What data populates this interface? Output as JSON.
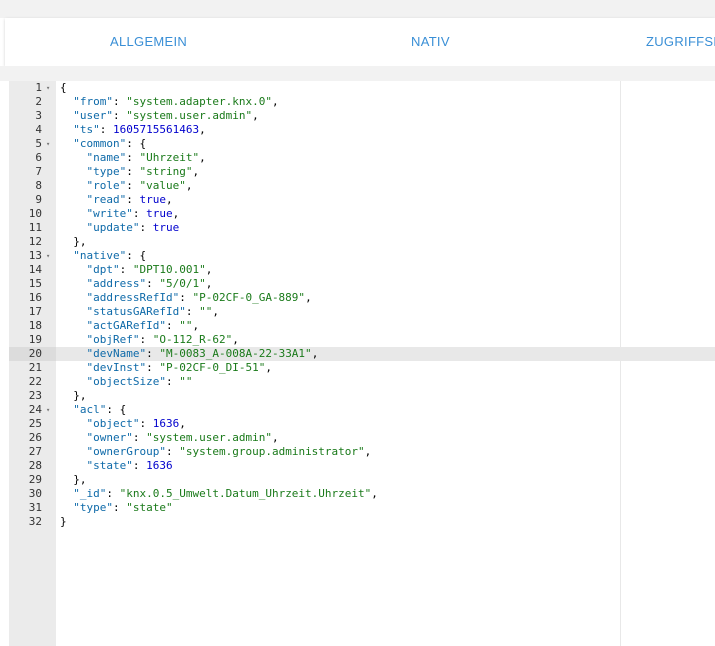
{
  "tabs": [
    {
      "label": "ALLGEMEIN"
    },
    {
      "label": "NATIV"
    },
    {
      "label": "ZUGRIFFSK"
    }
  ],
  "editor": {
    "active_line": 20,
    "fold_lines": [
      1,
      5,
      13,
      24
    ],
    "lines": [
      {
        "n": "1",
        "t": "{"
      },
      {
        "n": "2",
        "t": "  \"from\": \"system.adapter.knx.0\","
      },
      {
        "n": "3",
        "t": "  \"user\": \"system.user.admin\","
      },
      {
        "n": "4",
        "t": "  \"ts\": 1605715561463,"
      },
      {
        "n": "5",
        "t": "  \"common\": {"
      },
      {
        "n": "6",
        "t": "    \"name\": \"Uhrzeit\","
      },
      {
        "n": "7",
        "t": "    \"type\": \"string\","
      },
      {
        "n": "8",
        "t": "    \"role\": \"value\","
      },
      {
        "n": "9",
        "t": "    \"read\": true,"
      },
      {
        "n": "10",
        "t": "    \"write\": true,"
      },
      {
        "n": "11",
        "t": "    \"update\": true"
      },
      {
        "n": "12",
        "t": "  },"
      },
      {
        "n": "13",
        "t": "  \"native\": {"
      },
      {
        "n": "14",
        "t": "    \"dpt\": \"DPT10.001\","
      },
      {
        "n": "15",
        "t": "    \"address\": \"5/0/1\","
      },
      {
        "n": "16",
        "t": "    \"addressRefId\": \"P-02CF-0_GA-889\","
      },
      {
        "n": "17",
        "t": "    \"statusGARefId\": \"\","
      },
      {
        "n": "18",
        "t": "    \"actGARefId\": \"\","
      },
      {
        "n": "19",
        "t": "    \"objRef\": \"O-112_R-62\","
      },
      {
        "n": "20",
        "t": "    \"devName\": \"M-0083_A-008A-22-33A1\","
      },
      {
        "n": "21",
        "t": "    \"devInst\": \"P-02CF-0_DI-51\","
      },
      {
        "n": "22",
        "t": "    \"objectSize\": \"\""
      },
      {
        "n": "23",
        "t": "  },"
      },
      {
        "n": "24",
        "t": "  \"acl\": {"
      },
      {
        "n": "25",
        "t": "    \"object\": 1636,"
      },
      {
        "n": "26",
        "t": "    \"owner\": \"system.user.admin\","
      },
      {
        "n": "27",
        "t": "    \"ownerGroup\": \"system.group.administrator\","
      },
      {
        "n": "28",
        "t": "    \"state\": 1636"
      },
      {
        "n": "29",
        "t": "  },"
      },
      {
        "n": "30",
        "t": "  \"_id\": \"knx.0.5_Umwelt.Datum_Uhrzeit.Uhrzeit\","
      },
      {
        "n": "31",
        "t": "  \"type\": \"state\""
      },
      {
        "n": "32",
        "t": "}"
      }
    ]
  }
}
